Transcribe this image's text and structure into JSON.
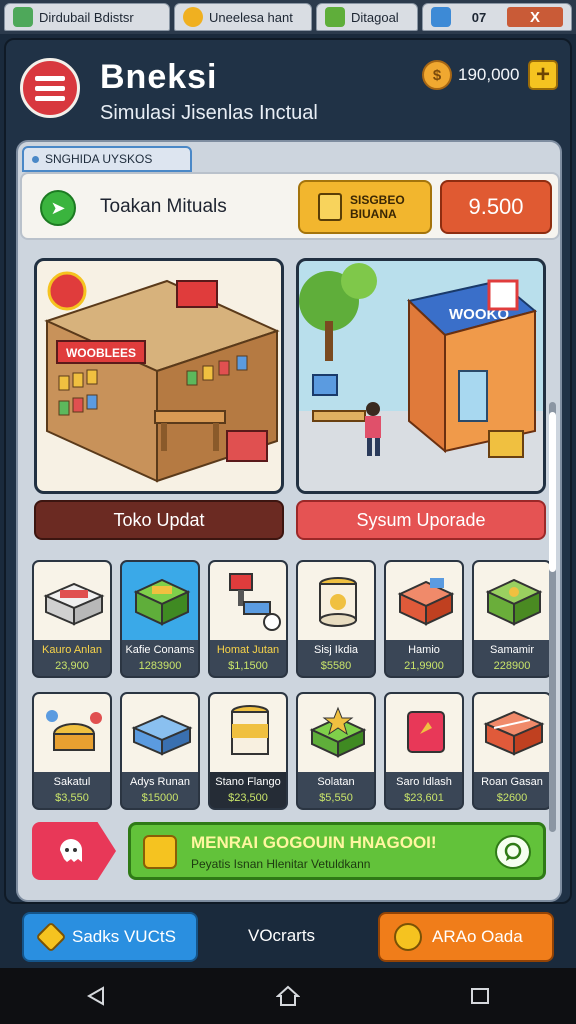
{
  "tabs": [
    {
      "label": "Dirdubail Bdistsr",
      "color": "#4ea85a"
    },
    {
      "label": "Uneelesa hant",
      "color": "#f0b020"
    },
    {
      "label": "Ditagoal",
      "color": "#5fae3a"
    },
    {
      "label": "07",
      "close": "X",
      "color": "#3d8ad6"
    }
  ],
  "header": {
    "title": "Bneksi",
    "subtitle": "Simulasi Jisenlas Inctual",
    "coins": "190,000",
    "plus": "+"
  },
  "section": {
    "tab_label": "SNGHIDA UYSKOS"
  },
  "infobar": {
    "label": "Toakan Mituals",
    "yellow_btn": "SISGBEO BIUANA",
    "red_btn": "9.500"
  },
  "scenes": {
    "left_sign": "WOOBLEES",
    "right_sign": "WOOKO",
    "left_button": "Toko Updat",
    "right_button": "Sysum Uporade"
  },
  "items_row1": [
    {
      "name": "Kauro Anlan",
      "price": "23,900"
    },
    {
      "name": "Kafie Conams",
      "price": "1283900"
    },
    {
      "name": "Homat Jutan",
      "price": "$1,1500"
    },
    {
      "name": "Sisj Ikdia",
      "price": "$5580"
    },
    {
      "name": "Hamio",
      "price": "21,9900"
    },
    {
      "name": "Samamir",
      "price": "228900"
    }
  ],
  "items_row2": [
    {
      "name": "Sakatul",
      "price": "$3,550"
    },
    {
      "name": "Adys Runan",
      "price": "$15000"
    },
    {
      "name": "Stano Flango",
      "price": "$23,500"
    },
    {
      "name": "Solatan",
      "price": "$5,550"
    },
    {
      "name": "Saro Idlash",
      "price": "$23,601"
    },
    {
      "name": "Roan Gasan",
      "price": "$2600"
    }
  ],
  "banner": {
    "line1": "MENRAI GOGOUIN HNAGOOI!",
    "line2": "Peyatis Isnan Hlenitar Vetuldkann"
  },
  "bottom_nav": {
    "left": "Sadks VUCtS",
    "middle": "VOcrarts",
    "right": "ARAo Oada"
  }
}
